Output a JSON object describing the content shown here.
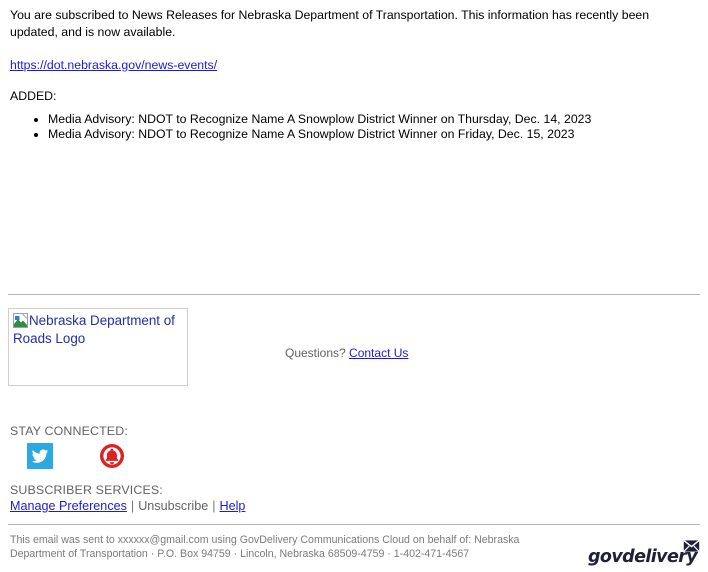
{
  "message": {
    "intro": "You are subscribed to News Releases for Nebraska Department of Transportation. This information has recently been updated, and is now available.",
    "url_text": "https://dot.nebraska.gov/news-events/",
    "added_label": "ADDED:",
    "items": [
      "Media Advisory: NDOT to Recognize Name A Snowplow District Winner on Thursday, Dec. 14, 2023",
      "Media Advisory: NDOT to Recognize Name A Snowplow District Winner on Friday, Dec. 15, 2023"
    ]
  },
  "footer": {
    "logo_alt_text": "Nebraska Department of Roads Logo",
    "logo_icon": "broken-image-icon",
    "questions_label": "Questions?",
    "contact_link": "Contact Us",
    "stay_connected_label": "STAY CONNECTED:",
    "social": [
      {
        "name": "twitter-icon",
        "label": "Twitter",
        "color": "#2ca9e1"
      },
      {
        "name": "subscribe-bell-icon",
        "label": "Subscribe",
        "color": "#dd2222"
      }
    ],
    "subscriber_services_label": "SUBSCRIBER SERVICES:",
    "manage_preferences": "Manage Preferences",
    "separator_1": "|",
    "unsubscribe": "Unsubscribe",
    "separator_2": "|",
    "help": "Help"
  },
  "legal": {
    "line1": "This email was sent to xxxxxx@gmail.com using GovDelivery Communications Cloud on behalf of: Nebraska Department of",
    "line2": "Transportation · P.O. Box 94759 · Lincoln, Nebraska 68509-4759 · 1-402-471-4567",
    "brand_wordmark": "govdelivery",
    "brand_icon": "envelope-icon"
  },
  "colors": {
    "link": "#1a1ae6",
    "muted_text": "#636363",
    "legal_text": "#7b7b7b",
    "alt_text": "#1f2fb0",
    "rule": "#b5b5b5",
    "twitter": "#2ca9e1",
    "bell": "#dd2222",
    "brand": "#20203a"
  }
}
